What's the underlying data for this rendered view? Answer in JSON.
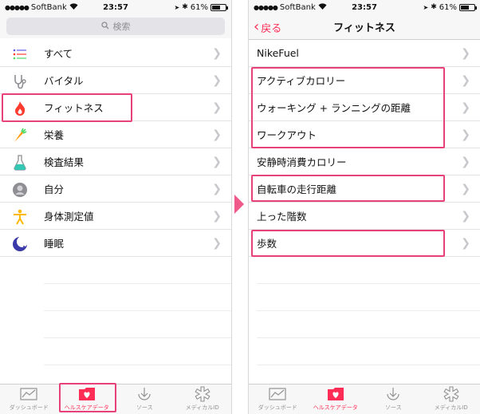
{
  "status": {
    "carrier": "SoftBank",
    "time": "23:57",
    "battery": "61%",
    "battery_level": 0.61
  },
  "left": {
    "search_placeholder": "検索",
    "items": [
      {
        "label": "すべて",
        "icon": "list-icon"
      },
      {
        "label": "バイタル",
        "icon": "stethoscope-icon"
      },
      {
        "label": "フィットネス",
        "icon": "flame-icon"
      },
      {
        "label": "栄養",
        "icon": "carrot-icon"
      },
      {
        "label": "検査結果",
        "icon": "flask-icon"
      },
      {
        "label": "自分",
        "icon": "person-silhouette-icon"
      },
      {
        "label": "身体測定値",
        "icon": "body-measurement-icon"
      },
      {
        "label": "睡眠",
        "icon": "moon-icon"
      }
    ]
  },
  "right": {
    "back_label": "戻る",
    "title": "フィットネス",
    "items": [
      {
        "label": "NikeFuel"
      },
      {
        "label": "アクティブカロリー"
      },
      {
        "label": "ウォーキング + ランニングの距離"
      },
      {
        "label": "ワークアウト"
      },
      {
        "label": "安静時消費カロリー"
      },
      {
        "label": "自転車の走行距離"
      },
      {
        "label": "上った階数"
      },
      {
        "label": "歩数"
      }
    ]
  },
  "tabs": [
    {
      "label": "ダッシュボード",
      "icon": "dashboard-chart-icon"
    },
    {
      "label": "ヘルスケアデータ",
      "icon": "health-folder-icon",
      "active": true
    },
    {
      "label": "ソース",
      "icon": "download-icon"
    },
    {
      "label": "メディカルID",
      "icon": "medical-id-icon"
    }
  ],
  "colors": {
    "accent": "#ff2d55",
    "highlight": "#e8417a"
  }
}
